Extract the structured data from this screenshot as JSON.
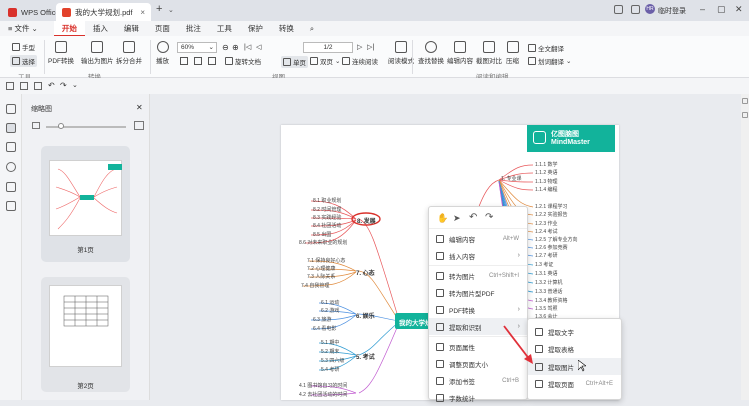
{
  "titlebar": {
    "tabs": [
      {
        "label": "WPS Office"
      },
      {
        "label": "我的大学规划.pdf"
      }
    ],
    "new_tab": "+",
    "login": "临时登录",
    "avatar_text": "HR"
  },
  "menubar": {
    "file": "文件",
    "items": [
      "开始",
      "插入",
      "编辑",
      "页面",
      "批注",
      "工具",
      "保护",
      "转换"
    ]
  },
  "ribbon": {
    "tools": {
      "hand": "手型",
      "select": "选择",
      "group": "工具"
    },
    "convert": {
      "pdf_convert": "PDF转换",
      "to_image": "输出为图片",
      "split_merge": "拆分合并",
      "group": "转换"
    },
    "view": {
      "play": "播放",
      "zoom": "60%",
      "page_field": "1/2",
      "rotate": "旋转文档",
      "single": "单页",
      "double": "双页",
      "continuous": "连续阅读",
      "read_mode": "阅读模式",
      "group": "视图"
    },
    "find": {
      "find_replace": "查找替换",
      "edit_content": "编辑内容",
      "screenshot_compare": "截图对比",
      "compress": "压缩",
      "fulltext_translate": "全文翻译",
      "word_translate": "划词翻译",
      "group": "阅读和编辑"
    }
  },
  "thumbpanel": {
    "title": "缩略图",
    "pages": [
      {
        "label": "第1页"
      },
      {
        "label": "第2页"
      }
    ]
  },
  "mindmap": {
    "brand_cn": "亿图脑图",
    "brand_en": "MindMaster",
    "center": "我的大学规",
    "branches": [
      {
        "label": "8. 发展"
      },
      {
        "label": "7. 心态"
      },
      {
        "label": "6. 娱乐"
      },
      {
        "label": "5. 考试"
      },
      {
        "label": "1. 专业课"
      }
    ],
    "leaves_left": [
      "8.1 职业规划",
      "8.2 时间管理",
      "8.3 实践经验",
      "8.4 社团活动",
      "8.5 出国",
      "8.6 对未来职业的规划",
      "7.1 保持良好心态",
      "7.2 心理健康",
      "7.3 人际关系",
      "7.4 自我管理",
      "6.1 运动",
      "6.2 游戏",
      "6.3 旅游",
      "6.4 看电影",
      "5.1 期中",
      "5.2 期末",
      "5.3 四六级",
      "5.4 考研",
      "4.1 图书馆自习的时间",
      "4.2 去社团活动的时间"
    ],
    "leaves_right": [
      "1.1.1 数学",
      "1.1.2 英语",
      "1.1.3 物理",
      "1.1.4 编程",
      "1.2.1 课程学习",
      "1.2.2 实验报告",
      "1.2.3 作业",
      "1.2.4 考试",
      "1.2.5 了解专业方向",
      "1.2.6 参加竞赛",
      "1.2.7 考研",
      "1.3 考证",
      "1.3.1 英语",
      "1.3.2 计算机",
      "1.3.3 普通话",
      "1.3.4 教师资格",
      "1.3.5 驾照",
      "1.3.6 会计"
    ]
  },
  "context_menu": {
    "items": [
      {
        "label": "编辑内容",
        "shortcut": "Alt+W"
      },
      {
        "label": "插入内容",
        "shortcut": ""
      },
      {
        "label": "转为图片",
        "shortcut": "Ctrl+Shift+I"
      },
      {
        "label": "转为图片型PDF",
        "shortcut": ""
      },
      {
        "label": "PDF转换",
        "shortcut": ""
      },
      {
        "label": "提取和识别",
        "shortcut": ""
      },
      {
        "label": "页面属性",
        "shortcut": ""
      },
      {
        "label": "调整页面大小",
        "shortcut": ""
      },
      {
        "label": "添加书签",
        "shortcut": "Ctrl+B"
      },
      {
        "label": "字数统计",
        "shortcut": ""
      }
    ]
  },
  "submenu": {
    "items": [
      {
        "label": "提取文字",
        "shortcut": ""
      },
      {
        "label": "提取表格",
        "shortcut": ""
      },
      {
        "label": "提取图片",
        "shortcut": ""
      },
      {
        "label": "提取页面",
        "shortcut": "Ctrl+Alt+E"
      }
    ]
  },
  "colors": {
    "accent": "#d9312b",
    "mindmaster": "#12b39b",
    "highlight_circle": "#d9312b",
    "arrow": "#e0303a"
  }
}
